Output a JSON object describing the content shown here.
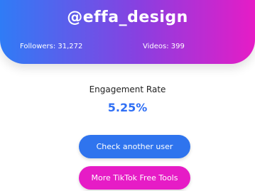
{
  "header": {
    "username": "@effa_design",
    "followers": "Followers: 31,272",
    "videos": "Videos: 399"
  },
  "engagement": {
    "label": "Engagement Rate",
    "value": "5.25%"
  },
  "actions": {
    "check_another": "Check another user",
    "more_tools": "More TikTok Free Tools"
  },
  "colors": {
    "gradient_start": "#2f7cf6",
    "gradient_end": "#e61cc6",
    "primary_button": "#2f74ee",
    "secondary_button": "#e61cc6",
    "value_text": "#2f6ff5"
  }
}
